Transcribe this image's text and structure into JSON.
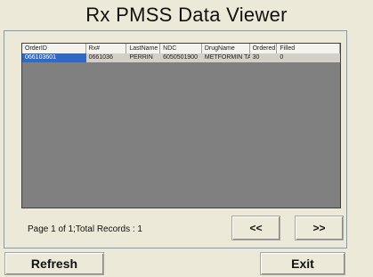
{
  "app": {
    "title": "Rx PMSS Data Viewer"
  },
  "grid": {
    "columns": [
      "OrderID",
      "Rx#",
      "LastName",
      "NDC",
      "DrugName",
      "Ordered",
      "Filled"
    ],
    "rows": [
      [
        "066103601",
        "0661036",
        "PERRIN",
        "6050501900",
        "METFORMIN TA",
        "30",
        "0"
      ]
    ]
  },
  "status": {
    "text": "Page 1 of 1;Total Records : 1"
  },
  "buttons": {
    "prev": "<<",
    "next": ">>",
    "refresh": "Refresh",
    "exit": "Exit"
  }
}
